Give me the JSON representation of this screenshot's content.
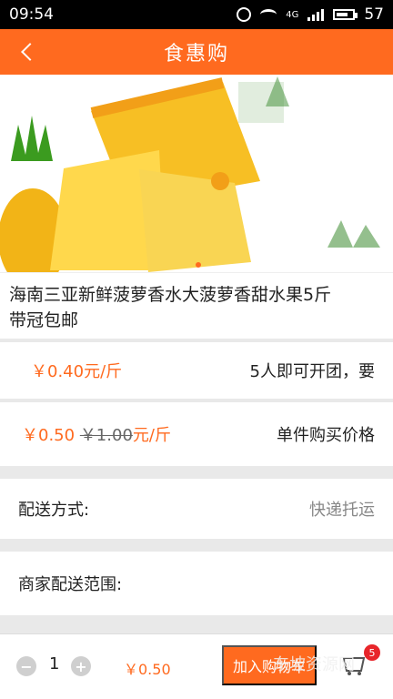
{
  "status": {
    "time": "09:54",
    "network": "4G",
    "battery": "57"
  },
  "nav": {
    "title": "食惠购"
  },
  "product": {
    "title_line1": "海南三亚新鲜菠萝香水大菠萝香甜水果5斤",
    "title_line2": "带冠包邮"
  },
  "group_deal": {
    "price": "￥0.40元/斤",
    "text": "5人即可开团，要"
  },
  "single": {
    "price": "￥0.50",
    "original": "￥1.00",
    "unit": "元/斤",
    "label": "单件购买价格"
  },
  "shipping": {
    "label": "配送方式:",
    "value": "快递托运"
  },
  "range": {
    "label": "商家配送范围:"
  },
  "bottom": {
    "qty": "1",
    "price": "￥0.50",
    "add_cart": "加入购物车",
    "badge": "5"
  },
  "watermark": "东坡资源网"
}
